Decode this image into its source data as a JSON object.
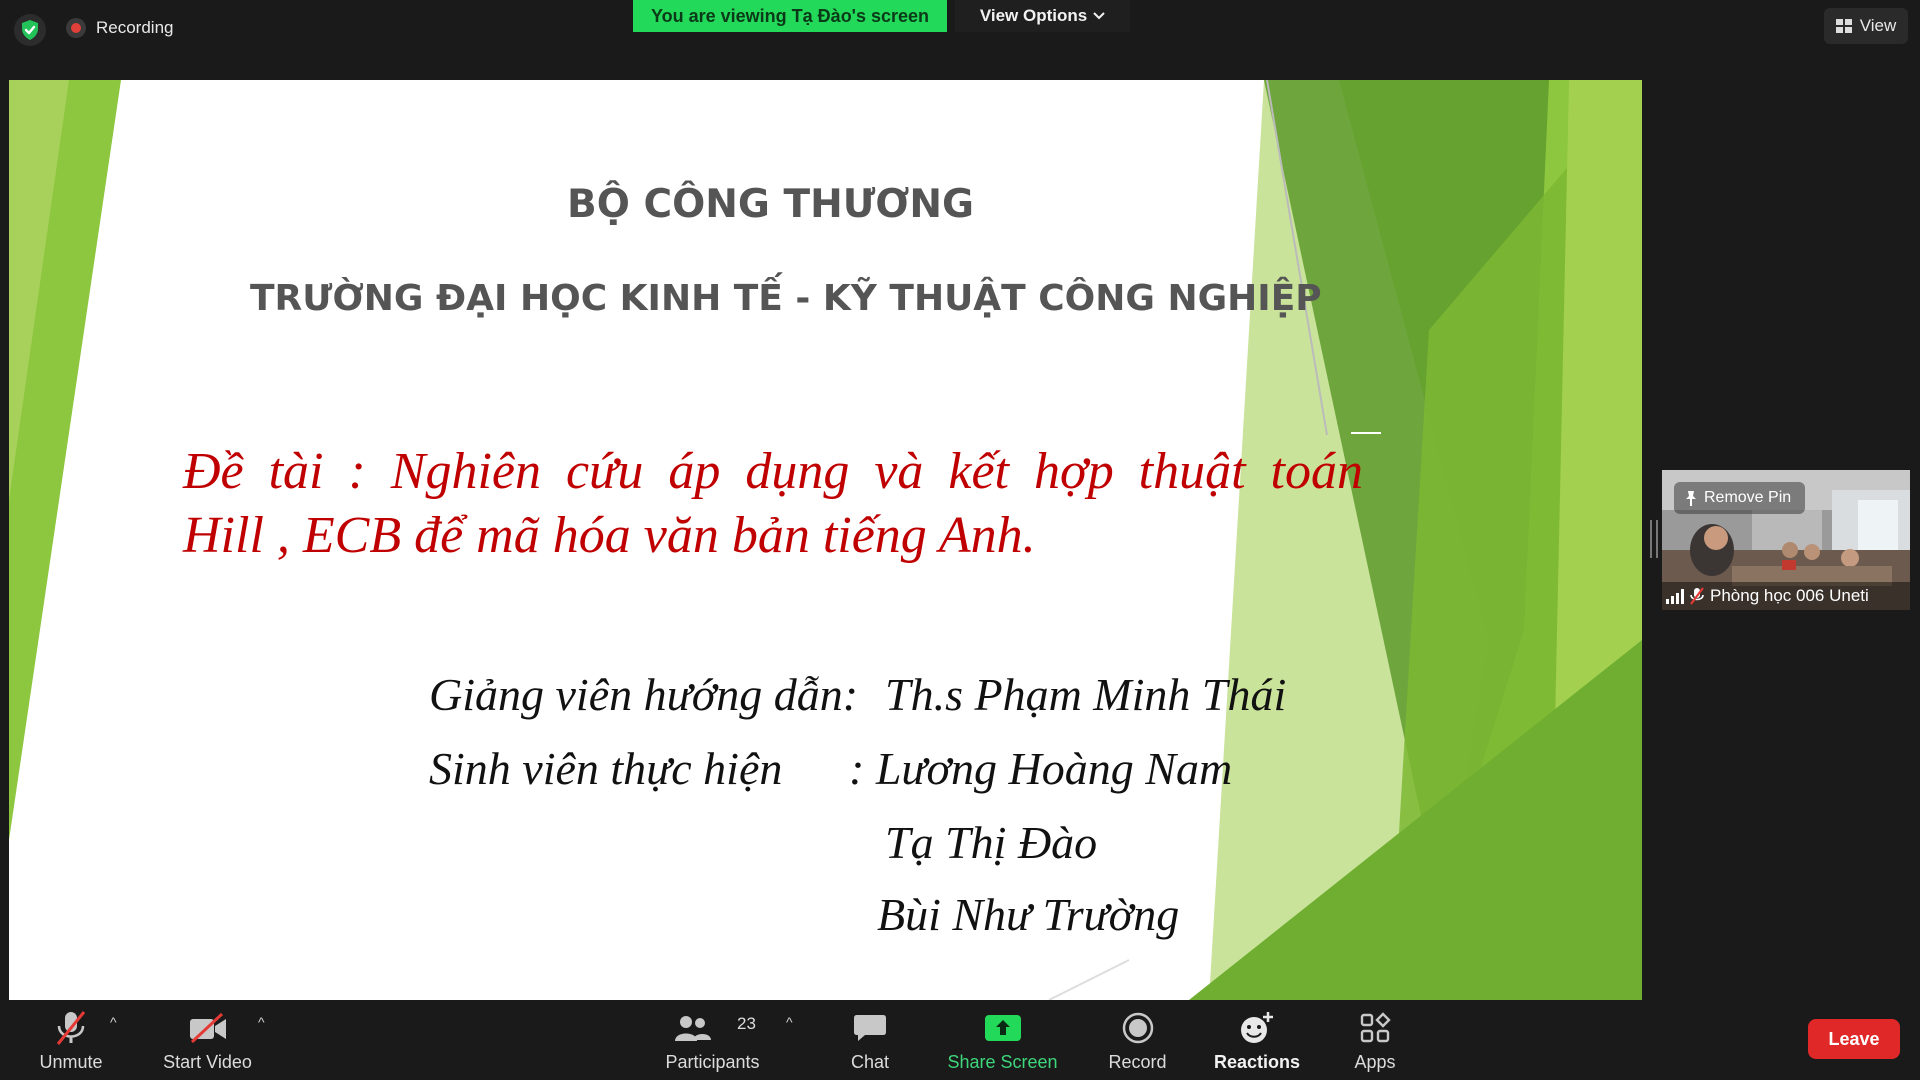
{
  "top_bar": {
    "security_icon": "shield-check-icon",
    "recording_label": "Recording",
    "viewing_banner": "You are viewing Tạ Đào's screen",
    "view_options_label": "View Options",
    "view_button_label": "View"
  },
  "shared_slide": {
    "org_line_1": "BỘ CÔNG THƯƠNG",
    "org_line_2": "TRƯỜNG ĐẠI HỌC KINH TẾ - KỸ THUẬT CÔNG NGHIỆP",
    "topic_line_1": "Đề tài : Nghiên cứu áp dụng và kết hợp thuật toán",
    "topic_line_2": "Hill , ECB để mã hóa văn bản tiếng Anh.",
    "supervisor_label": "Giảng viên hướng dẫn:",
    "supervisor_name": "Th.s Phạm Minh Thái",
    "students_label": "Sinh viên thực hiện",
    "students": [
      ": Lương Hoàng Nam",
      "Tạ Thị Đào",
      "Bùi Như Trường"
    ],
    "colors": {
      "accent_green": "#8dc63f",
      "dark_green": "#5e9b2d",
      "topic_red": "#c00000"
    }
  },
  "participant_thumbnail": {
    "remove_pin_label": "Remove Pin",
    "name": "Phòng học 006 Uneti",
    "mic_state": "muted"
  },
  "toolbar": {
    "unmute_label": "Unmute",
    "start_video_label": "Start Video",
    "participants_label": "Participants",
    "participants_count": "23",
    "chat_label": "Chat",
    "share_screen_label": "Share Screen",
    "record_label": "Record",
    "reactions_label": "Reactions",
    "apps_label": "Apps",
    "leave_label": "Leave",
    "colors": {
      "share_green": "#23d959",
      "leave_red": "#e02828"
    }
  }
}
